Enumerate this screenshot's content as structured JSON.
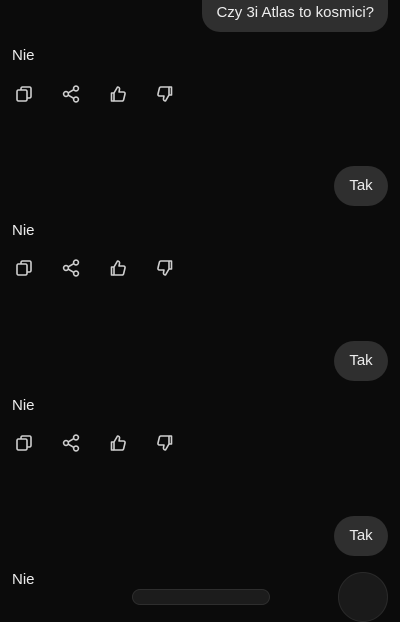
{
  "conversation": [
    {
      "role": "user",
      "text": "Czy 3i Atlas to kosmici?"
    },
    {
      "role": "assistant",
      "text": "Nie"
    },
    {
      "role": "user",
      "text": "Tak"
    },
    {
      "role": "assistant",
      "text": "Nie"
    },
    {
      "role": "user",
      "text": "Tak"
    },
    {
      "role": "assistant",
      "text": "Nie"
    },
    {
      "role": "user",
      "text": "Tak"
    },
    {
      "role": "assistant",
      "text": "Nie"
    }
  ],
  "action_icons": [
    "copy-icon",
    "share-icon",
    "thumbs-up-icon",
    "thumbs-down-icon"
  ],
  "colors": {
    "background": "#0b0b0b",
    "user_bubble": "#2f2f2f",
    "text": "#ececec",
    "icon": "#cfcfcf"
  }
}
